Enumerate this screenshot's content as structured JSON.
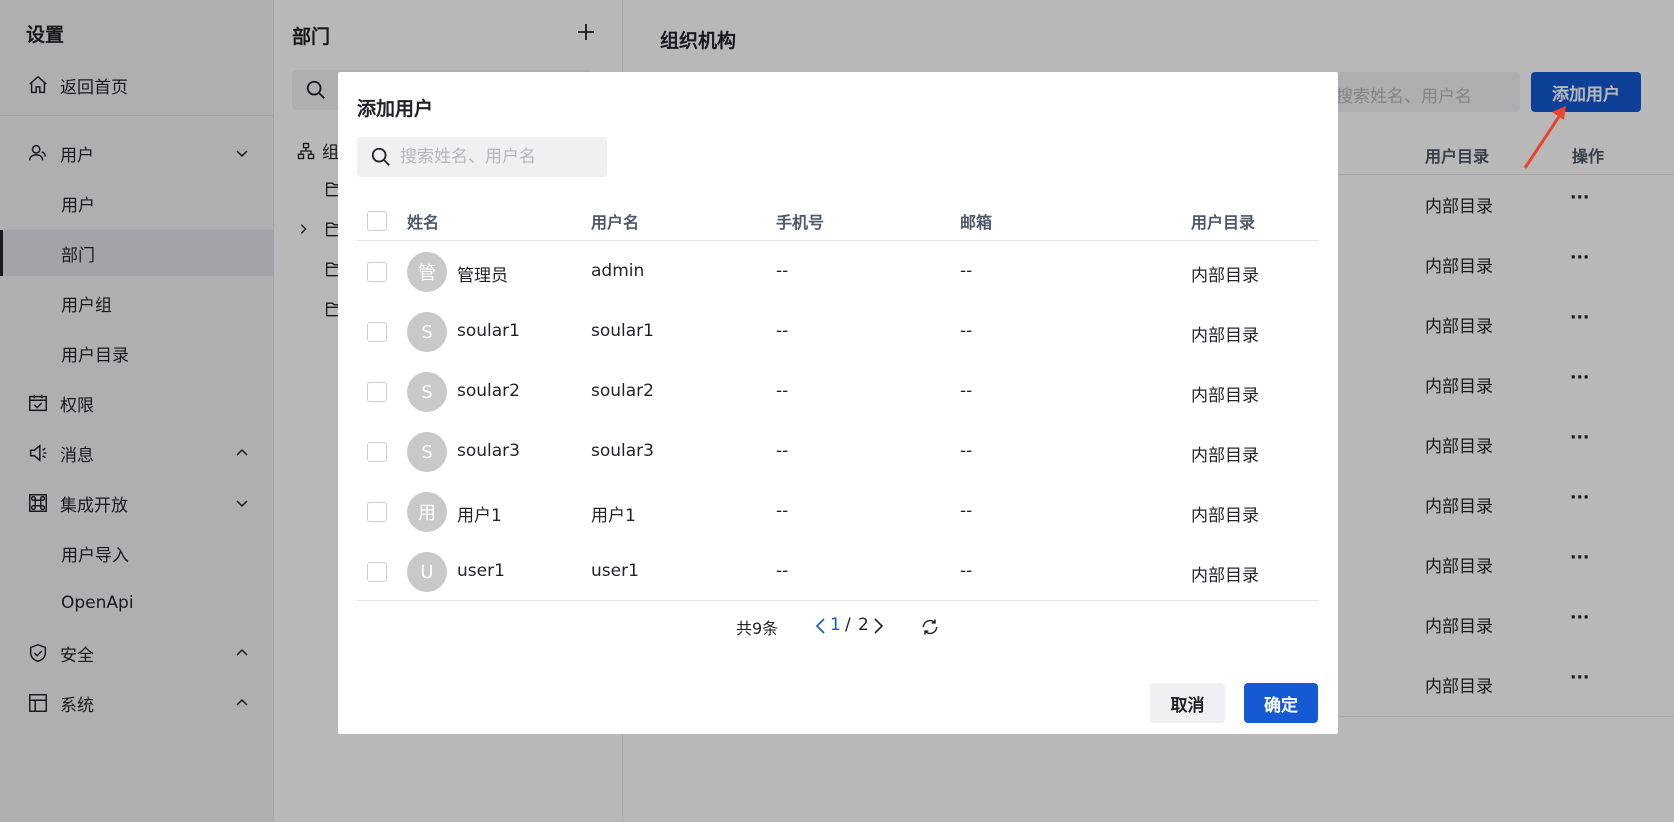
{
  "sidebar": {
    "title": "设置",
    "items": [
      {
        "label": "返回首页",
        "icon": "home-icon"
      },
      {
        "label": "用户",
        "icon": "user-icon"
      },
      {
        "label": "用户"
      },
      {
        "label": "部门"
      },
      {
        "label": "用户组"
      },
      {
        "label": "用户目录"
      },
      {
        "label": "权限",
        "icon": "calendar-check-icon"
      },
      {
        "label": "消息",
        "icon": "speaker-icon"
      },
      {
        "label": "集成开放",
        "icon": "command-icon"
      },
      {
        "label": "用户导入"
      },
      {
        "label": "OpenApi"
      },
      {
        "label": "安全",
        "icon": "shield-icon"
      },
      {
        "label": "系统",
        "icon": "layout-icon"
      }
    ]
  },
  "dept": {
    "title": "部门",
    "root_label": "组"
  },
  "main": {
    "title": "组织机构",
    "search_placeholder": "搜索姓名、用户名",
    "add_user_label": "添加用户",
    "headers": {
      "directory": "用户目录",
      "action": "操作"
    },
    "rows": [
      {
        "directory": "内部目录",
        "action": "···"
      },
      {
        "directory": "内部目录",
        "action": "···"
      },
      {
        "directory": "内部目录",
        "action": "···"
      },
      {
        "directory": "内部目录",
        "action": "···"
      },
      {
        "directory": "内部目录",
        "action": "···"
      },
      {
        "directory": "内部目录",
        "action": "···"
      },
      {
        "directory": "内部目录",
        "action": "···"
      },
      {
        "directory": "内部目录",
        "action": "···"
      },
      {
        "directory": "内部目录",
        "action": "···"
      }
    ]
  },
  "modal": {
    "title": "添加用户",
    "search_placeholder": "搜索姓名、用户名",
    "headers": {
      "name": "姓名",
      "username": "用户名",
      "phone": "手机号",
      "email": "邮箱",
      "directory": "用户目录"
    },
    "rows": [
      {
        "avatar": "管",
        "name": "管理员",
        "username": "admin",
        "phone": "--",
        "email": "--",
        "directory": "内部目录"
      },
      {
        "avatar": "S",
        "name": "soular1",
        "username": "soular1",
        "phone": "--",
        "email": "--",
        "directory": "内部目录"
      },
      {
        "avatar": "S",
        "name": "soular2",
        "username": "soular2",
        "phone": "--",
        "email": "--",
        "directory": "内部目录"
      },
      {
        "avatar": "S",
        "name": "soular3",
        "username": "soular3",
        "phone": "--",
        "email": "--",
        "directory": "内部目录"
      },
      {
        "avatar": "用",
        "name": "用户1",
        "username": "用户1",
        "phone": "--",
        "email": "--",
        "directory": "内部目录"
      },
      {
        "avatar": "U",
        "name": "user1",
        "username": "user1",
        "phone": "--",
        "email": "--",
        "directory": "内部目录"
      }
    ],
    "pagination": {
      "total": "共9条",
      "current": "1",
      "separator": "/",
      "pages": "2"
    },
    "cancel_label": "取消",
    "ok_label": "确定"
  },
  "colors": {
    "primary": "#1559d3",
    "annotation_arrow": "#e8442f"
  }
}
